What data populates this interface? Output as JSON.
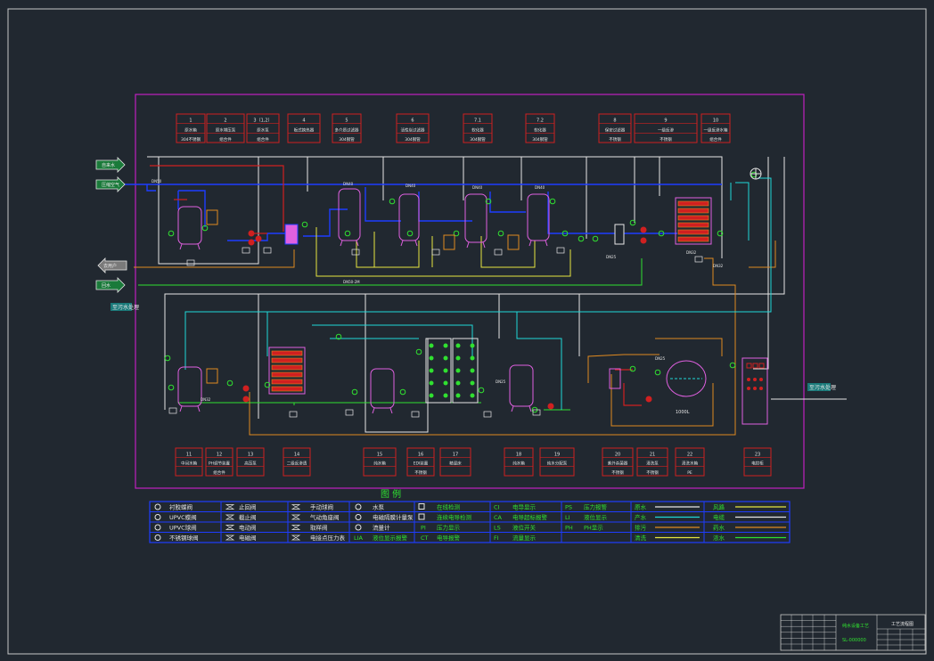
{
  "drawing": {
    "legend_title": "图 例",
    "colors": {
      "frame": "#c8c8c8",
      "border": "#c020c0",
      "pipe_blue": "#1e3cff",
      "pipe_white": "#e6e6e6",
      "pipe_yellow": "#e6e640",
      "pipe_orange": "#e08a20",
      "pipe_cyan": "#20d8d8",
      "pipe_green": "#30e030",
      "equip_red": "#d02020",
      "equip_pink": "#e060e0",
      "legend_blue": "#1e3cff",
      "legend_green": "#30e030"
    }
  },
  "top_equipment": [
    {
      "no": "1",
      "name": "原水箱",
      "mat": "304不锈钢"
    },
    {
      "no": "2",
      "name": "原水增压泵",
      "mat": "组合件"
    },
    {
      "no": "3（1,2）",
      "name": "原水泵",
      "mat": "组合件"
    },
    {
      "no": "4",
      "name": "板式换热器",
      "mat": ""
    },
    {
      "no": "5",
      "name": "多介质过滤器",
      "mat": "304钢管"
    },
    {
      "no": "6",
      "name": "活性炭过滤器",
      "mat": "304钢管"
    },
    {
      "no": "7.1",
      "name": "软化器",
      "mat": "304钢管"
    },
    {
      "no": "7.2",
      "name": "软化器",
      "mat": "304钢管"
    },
    {
      "no": "8",
      "name": "保安过滤器",
      "mat": "不锈钢"
    },
    {
      "no": "9",
      "name": "一级反渗",
      "mat": "不锈钢"
    },
    {
      "no": "10",
      "name": "一级反渗水箱",
      "mat": "组合件"
    }
  ],
  "bottom_equipment": [
    {
      "no": "11",
      "name": "中间水箱",
      "mat": ""
    },
    {
      "no": "12",
      "name": "PH调节装置",
      "mat": "组合件"
    },
    {
      "no": "13",
      "name": "高压泵",
      "mat": ""
    },
    {
      "no": "14",
      "name": "二级反渗透",
      "mat": ""
    },
    {
      "no": "15",
      "name": "纯水箱",
      "mat": ""
    },
    {
      "no": "16",
      "name": "EDI装置",
      "mat": "不锈钢"
    },
    {
      "no": "17",
      "name": "精混床",
      "mat": ""
    },
    {
      "no": "18",
      "name": "纯水箱",
      "mat": ""
    },
    {
      "no": "19",
      "name": "纯水分配泵",
      "mat": ""
    },
    {
      "no": "20",
      "name": "紫外杀菌器",
      "mat": "不锈钢"
    },
    {
      "no": "21",
      "name": "清洗泵",
      "mat": "不锈钢"
    },
    {
      "no": "22",
      "name": "清洗水箱",
      "mat": "PE"
    },
    {
      "no": "23",
      "name": "电控柜",
      "mat": ""
    }
  ],
  "inlets": [
    {
      "label": "自来水"
    },
    {
      "label": "压缩空气"
    },
    {
      "label": "去用户"
    },
    {
      "label": "回水"
    }
  ],
  "notes": {
    "left_note": "至污水处理",
    "right_note": "至污水处理",
    "tank_note": "1000L"
  },
  "legend": {
    "col1": [
      "衬胶蝶阀",
      "UPVC蝶阀",
      "UPVC球阀",
      "不锈钢球阀"
    ],
    "col2": [
      "止回阀",
      "截止阀",
      "电动阀",
      "电磁阀"
    ],
    "col3": [
      "手动球阀",
      "气动角座阀",
      "取样阀",
      "电接点压力表"
    ],
    "col4": [
      "水泵",
      "电磁隔膜计量泵",
      "流量计",
      "LIA"
    ],
    "col4b": [
      "",
      "",
      "",
      "液位显示报警"
    ],
    "col5": [
      "在线检测",
      "连续电导检测",
      "PI",
      "CT"
    ],
    "col5b": [
      "",
      "",
      "压力显示",
      "电导报警"
    ],
    "col6": [
      "CI",
      "CA",
      "LS",
      "FI"
    ],
    "col6b": [
      "电导显示",
      "电导超标报警",
      "液位开关",
      "流量显示"
    ],
    "col7": [
      "PS",
      "LI",
      "PH",
      ""
    ],
    "col7b": [
      "压力报警",
      "液位显示",
      "PH显示",
      ""
    ],
    "col8": [
      "原水",
      "产水",
      "排污",
      "清洗"
    ],
    "col9": [
      "风路",
      "电缆",
      "药水",
      "浓水"
    ]
  },
  "title_block": {
    "project": "纯水设备工艺",
    "drawing": "工艺流程图",
    "code": "SL-000000"
  }
}
